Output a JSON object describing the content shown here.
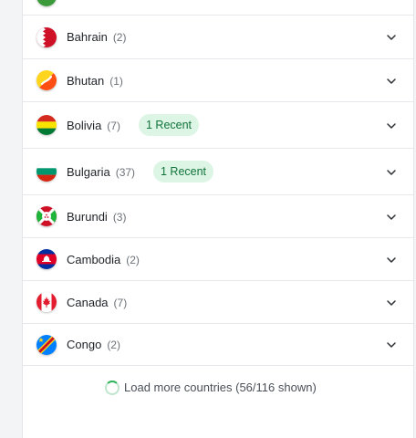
{
  "countries": [
    {
      "name": "Bahrain",
      "count": "(2)",
      "badge": ""
    },
    {
      "name": "Bhutan",
      "count": "(1)",
      "badge": ""
    },
    {
      "name": "Bolivia",
      "count": "(7)",
      "badge": "1 Recent"
    },
    {
      "name": "Bulgaria",
      "count": "(37)",
      "badge": "1 Recent"
    },
    {
      "name": "Burundi",
      "count": "(3)",
      "badge": ""
    },
    {
      "name": "Cambodia",
      "count": "(2)",
      "badge": ""
    },
    {
      "name": "Canada",
      "count": "(7)",
      "badge": ""
    },
    {
      "name": "Congo",
      "count": "(2)",
      "badge": ""
    }
  ],
  "load_more": {
    "label": "Load more countries (56/116 shown)"
  },
  "colors": {
    "badge_bg": "#dcf5e4",
    "badge_text": "#12733b",
    "spinner": "#2bb35a"
  },
  "icons": {
    "row_toggle": "chevron-down-icon",
    "loading": "spinner-icon"
  }
}
